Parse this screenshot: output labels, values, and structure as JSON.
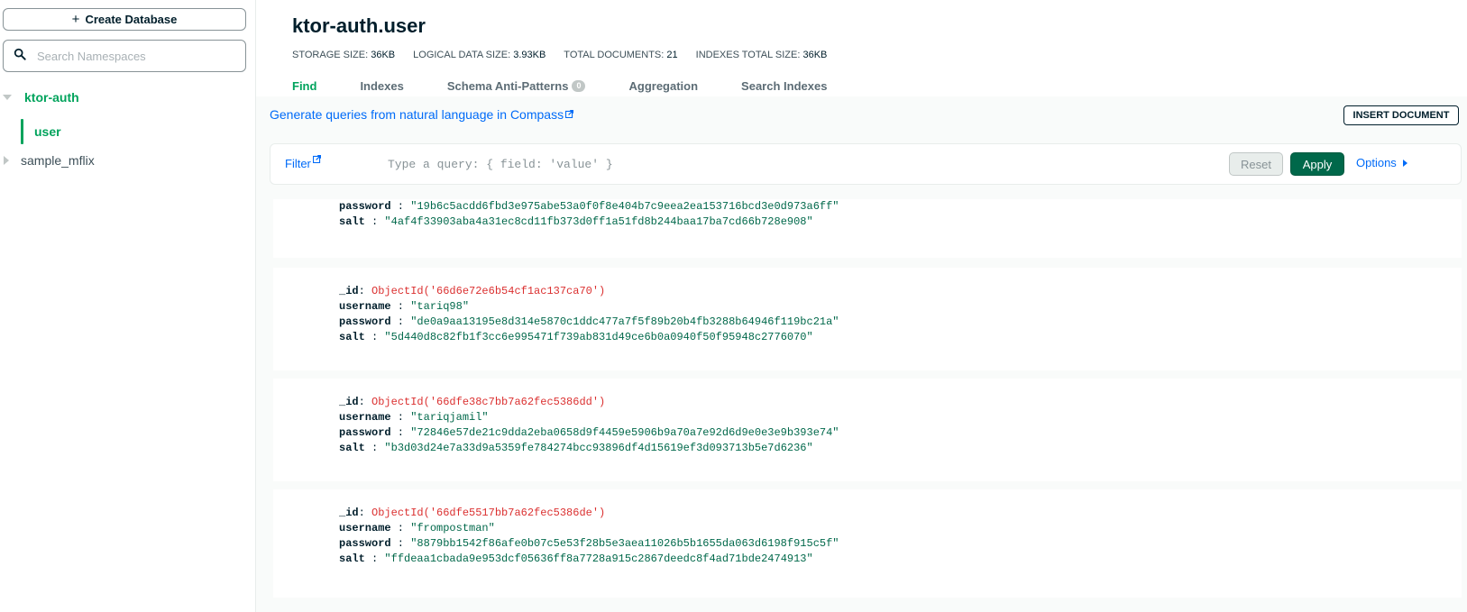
{
  "sidebar": {
    "create_label": "Create Database",
    "search_placeholder": "Search Namespaces",
    "db_active": "ktor-auth",
    "collection_active": "user",
    "db_other": "sample_mflix"
  },
  "header": {
    "title": "ktor-auth.user",
    "stats": {
      "storage_label": "STORAGE SIZE:",
      "storage_value": "36KB",
      "logical_label": "LOGICAL DATA SIZE:",
      "logical_value": "3.93KB",
      "docs_label": "TOTAL DOCUMENTS:",
      "docs_value": "21",
      "indexes_label": "INDEXES TOTAL SIZE:",
      "indexes_value": "36KB"
    },
    "tabs": [
      {
        "label": "Find"
      },
      {
        "label": "Indexes"
      },
      {
        "label": "Schema Anti-Patterns",
        "badge": "0"
      },
      {
        "label": "Aggregation"
      },
      {
        "label": "Search Indexes"
      }
    ]
  },
  "toolbar": {
    "nl_link": "Generate queries from natural language in Compass",
    "insert_label": "INSERT DOCUMENT",
    "filter_label": "Filter",
    "query_placeholder": "Type a query: { field: 'value' }",
    "reset_label": "Reset",
    "apply_label": "Apply",
    "options_label": "Options"
  },
  "documents": [
    {
      "password": "\"19b6c5acdd6fbd3e975abe53a0f0f8e404b7c9eea2ea153716bcd3e0d973a6ff\"",
      "salt": "\"4af4f33903aba4a31ec8cd11fb373d0ff1a51fd8b244baa17ba7cd66b728e908\""
    },
    {
      "_id": "ObjectId('66d6e72e6b54cf1ac137ca70')",
      "username": "\"tariq98\"",
      "password": "\"de0a9aa13195e8d314e5870c1ddc477a7f5f89b20b4fb3288b64946f119bc21a\"",
      "salt": "\"5d440d8c82fb1f3cc6e995471f739ab831d49ce6b0a0940f50f95948c2776070\""
    },
    {
      "_id": "ObjectId('66dfe38c7bb7a62fec5386dd')",
      "username": "\"tariqjamil\"",
      "password": "\"72846e57de21c9dda2eba0658d9f4459e5906b9a70a7e92d6d9e0e3e9b393e74\"",
      "salt": "\"b3d03d24e7a33d9a5359fe784274bcc93896df4d15619ef3d093713b5e7d6236\""
    },
    {
      "_id": "ObjectId('66dfe5517bb7a62fec5386de')",
      "username": "\"frompostman\"",
      "password": "\"8879bb1542f86afe0b07c5e53f28b5e3aea11026b5b1655da063d6198f915c5f\"",
      "salt": "\"ffdeaa1cbada9e953dcf05636ff8a7728a915c2867deedc8f4ad71bde2474913\""
    }
  ],
  "field_keys": {
    "id": "_id",
    "username": "username",
    "password": "password",
    "salt": "salt"
  }
}
